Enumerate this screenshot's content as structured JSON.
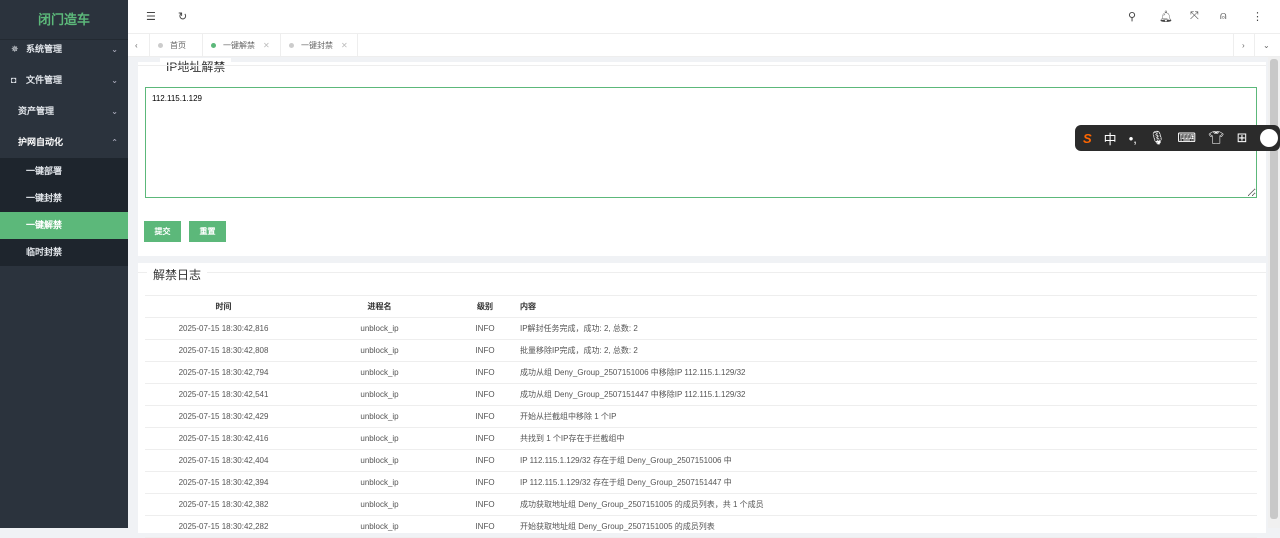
{
  "sidebar": {
    "logo": "闭门造车",
    "menus": [
      {
        "label": "系统管理",
        "icon": "gear-icon"
      },
      {
        "label": "文件管理",
        "icon": "camera-icon"
      },
      {
        "label": "资产管理"
      },
      {
        "label": "护网自动化"
      }
    ],
    "submenu": [
      {
        "label": "一键部署"
      },
      {
        "label": "一键封禁"
      },
      {
        "label": "一键解禁",
        "active": true
      },
      {
        "label": "临时封禁"
      }
    ]
  },
  "tabs": [
    {
      "label": "首页"
    },
    {
      "label": "一键解禁",
      "active": true
    },
    {
      "label": "一键封禁"
    }
  ],
  "form": {
    "title": "IP地址解禁",
    "ip_value": "112.115.1.129",
    "submit": "提交",
    "reset": "重置"
  },
  "log": {
    "title": "解禁日志",
    "headers": [
      "时间",
      "进程名",
      "级别",
      "内容"
    ],
    "rows": [
      [
        "2025-07-15 18:30:42,816",
        "unblock_ip",
        "INFO",
        "IP解封任务完成，成功: 2, 总数: 2"
      ],
      [
        "2025-07-15 18:30:42,808",
        "unblock_ip",
        "INFO",
        "批量移除IP完成，成功: 2, 总数: 2"
      ],
      [
        "2025-07-15 18:30:42,794",
        "unblock_ip",
        "INFO",
        "成功从组 Deny_Group_2507151006 中移除IP 112.115.1.129/32"
      ],
      [
        "2025-07-15 18:30:42,541",
        "unblock_ip",
        "INFO",
        "成功从组 Deny_Group_2507151447 中移除IP 112.115.1.129/32"
      ],
      [
        "2025-07-15 18:30:42,429",
        "unblock_ip",
        "INFO",
        "开始从拦截组中移除 1 个IP"
      ],
      [
        "2025-07-15 18:30:42,416",
        "unblock_ip",
        "INFO",
        "共找到 1 个IP存在于拦截组中"
      ],
      [
        "2025-07-15 18:30:42,404",
        "unblock_ip",
        "INFO",
        "IP 112.115.1.129/32 存在于组 Deny_Group_2507151006 中"
      ],
      [
        "2025-07-15 18:30:42,394",
        "unblock_ip",
        "INFO",
        "IP 112.115.1.129/32 存在于组 Deny_Group_2507151447 中"
      ],
      [
        "2025-07-15 18:30:42,382",
        "unblock_ip",
        "INFO",
        "成功获取地址组 Deny_Group_2507151005 的成员列表，共 1 个成员"
      ],
      [
        "2025-07-15 18:30:42,282",
        "unblock_ip",
        "INFO",
        "开始获取地址组 Deny_Group_2507151005 的成员列表"
      ]
    ]
  },
  "ime": {
    "mode": "中"
  },
  "colors": {
    "accent": "#5cb87a",
    "sidebar": "#2b333d"
  }
}
